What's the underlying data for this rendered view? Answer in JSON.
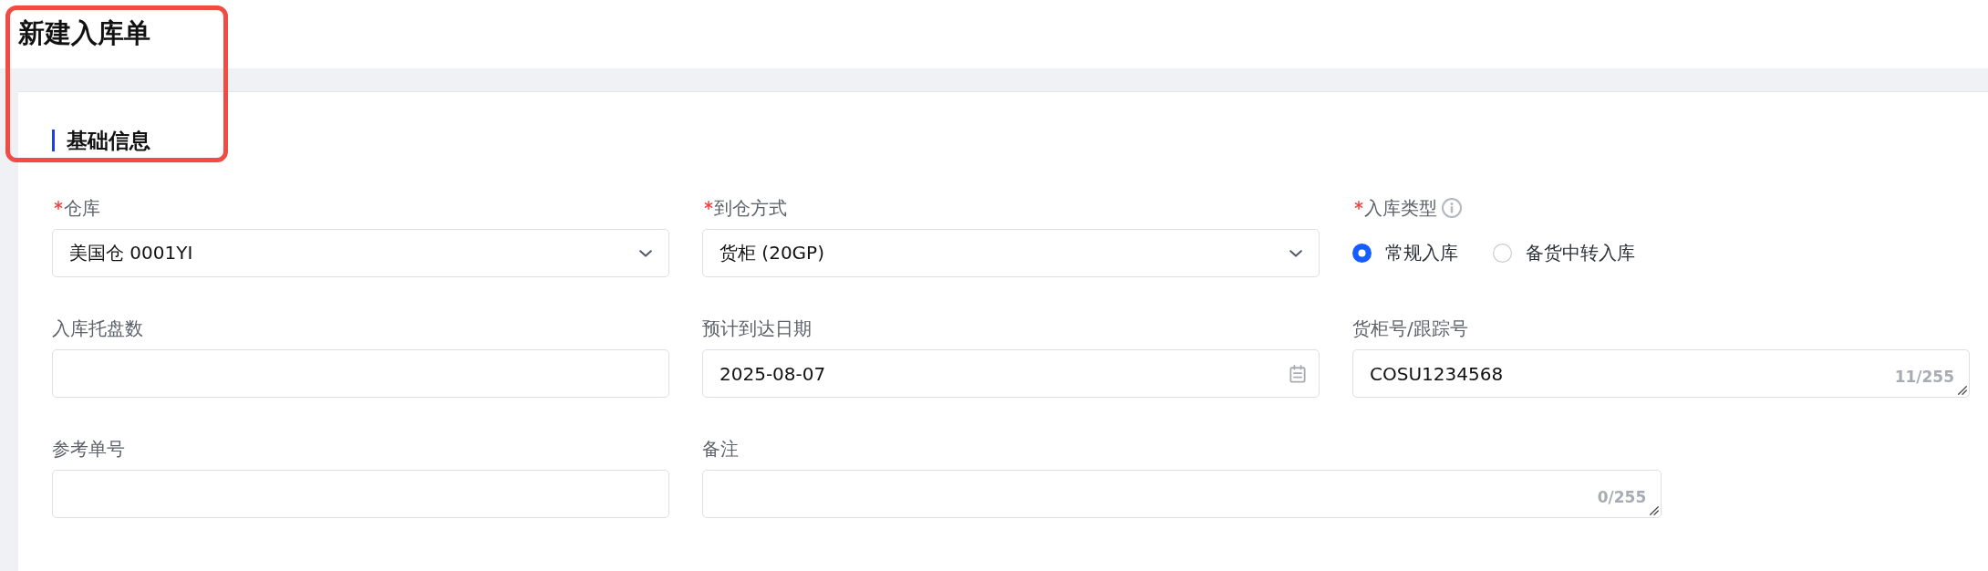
{
  "page": {
    "title": "新建入库单"
  },
  "highlight": true,
  "section": {
    "title": "基础信息"
  },
  "fields": [
    {
      "kind": "select",
      "label": "仓库",
      "required": true,
      "value": "美国仓 0001YI"
    },
    {
      "kind": "select",
      "label": "到仓方式",
      "required": true,
      "value": "货柜 (20GP)"
    },
    {
      "kind": "radio",
      "label": "入库类型",
      "required": true,
      "info": true,
      "options": [
        {
          "label": "常规入库",
          "selected": true
        },
        {
          "label": "备货中转入库",
          "selected": false
        }
      ]
    },
    {
      "kind": "input",
      "label": "入库托盘数",
      "required": false
    },
    {
      "kind": "date",
      "label": "预计到达日期",
      "required": false,
      "value": "2025-08-07"
    },
    {
      "kind": "textarea",
      "label": "货柜号/跟踪号",
      "required": false,
      "value": "COSU1234568",
      "counter": "11/255"
    },
    {
      "kind": "input",
      "label": "参考单号",
      "required": false
    },
    {
      "kind": "textarea",
      "label": "备注",
      "required": false,
      "counter": "0/255"
    }
  ]
}
